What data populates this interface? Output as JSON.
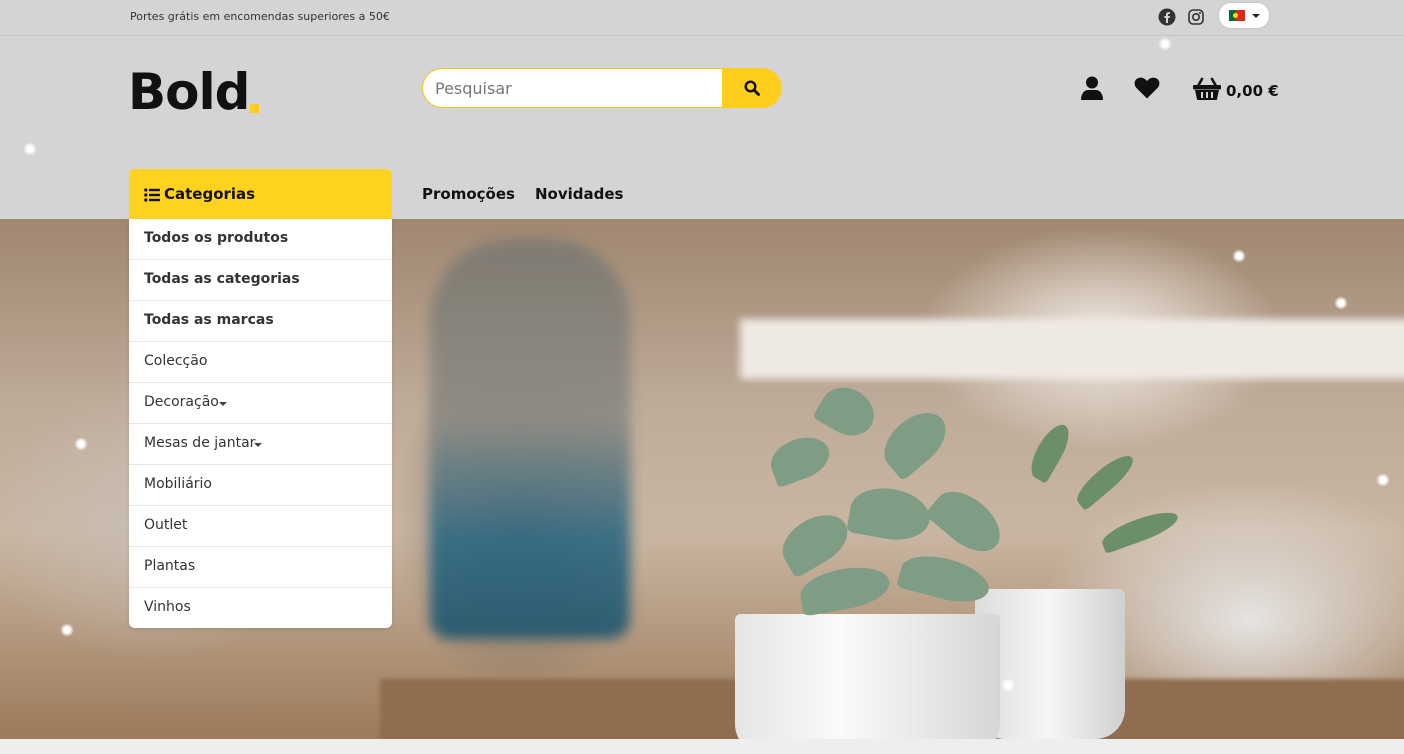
{
  "topbar": {
    "promo": "Portes grátis em encomendas superiores a 50€",
    "social": [
      "facebook-icon",
      "instagram-icon"
    ],
    "language": "pt"
  },
  "header": {
    "logo": "Bold",
    "search_placeholder": "Pesquisar",
    "cart_total": "0,00 €"
  },
  "nav": {
    "categories_label": "Categorias",
    "links": [
      "Promoções",
      "Novidades"
    ]
  },
  "categories": [
    {
      "label": "Todos os produtos",
      "bold": true
    },
    {
      "label": "Todas as categorias",
      "bold": true
    },
    {
      "label": "Todas as marcas",
      "bold": true
    },
    {
      "label": "Colecção"
    },
    {
      "label": "Decoração",
      "dropdown": true
    },
    {
      "label": "Mesas de jantar",
      "dropdown": true
    },
    {
      "label": "Mobiliário"
    },
    {
      "label": "Outlet"
    },
    {
      "label": "Plantas"
    },
    {
      "label": "Vinhos"
    }
  ],
  "colors": {
    "accent": "#ffd21f",
    "background": "#d4d4d4"
  }
}
